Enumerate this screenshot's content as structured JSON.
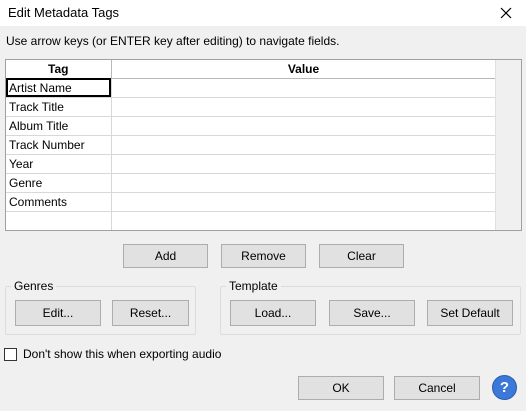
{
  "window": {
    "title": "Edit Metadata Tags",
    "close_icon": "close-icon"
  },
  "instructions": "Use arrow keys (or ENTER key after editing) to navigate fields.",
  "table": {
    "headers": [
      "Tag",
      "Value"
    ],
    "rows": [
      {
        "tag": "Artist Name",
        "value": ""
      },
      {
        "tag": "Track Title",
        "value": ""
      },
      {
        "tag": "Album Title",
        "value": ""
      },
      {
        "tag": "Track Number",
        "value": ""
      },
      {
        "tag": "Year",
        "value": ""
      },
      {
        "tag": "Genre",
        "value": ""
      },
      {
        "tag": "Comments",
        "value": ""
      },
      {
        "tag": "",
        "value": ""
      }
    ]
  },
  "row_buttons": {
    "add": "Add",
    "remove": "Remove",
    "clear": "Clear"
  },
  "genres": {
    "label": "Genres",
    "edit": "Edit...",
    "reset": "Reset..."
  },
  "template": {
    "label": "Template",
    "load": "Load...",
    "save": "Save...",
    "set_default": "Set Default"
  },
  "dont_show": {
    "label": "Don't show this when exporting audio",
    "checked": false
  },
  "dialog_buttons": {
    "ok": "OK",
    "cancel": "Cancel",
    "help": "?"
  },
  "colors": {
    "help_blue": "#3c78d8",
    "button_face": "#e1e1e1",
    "dialog_bg": "#f0f0f0"
  }
}
